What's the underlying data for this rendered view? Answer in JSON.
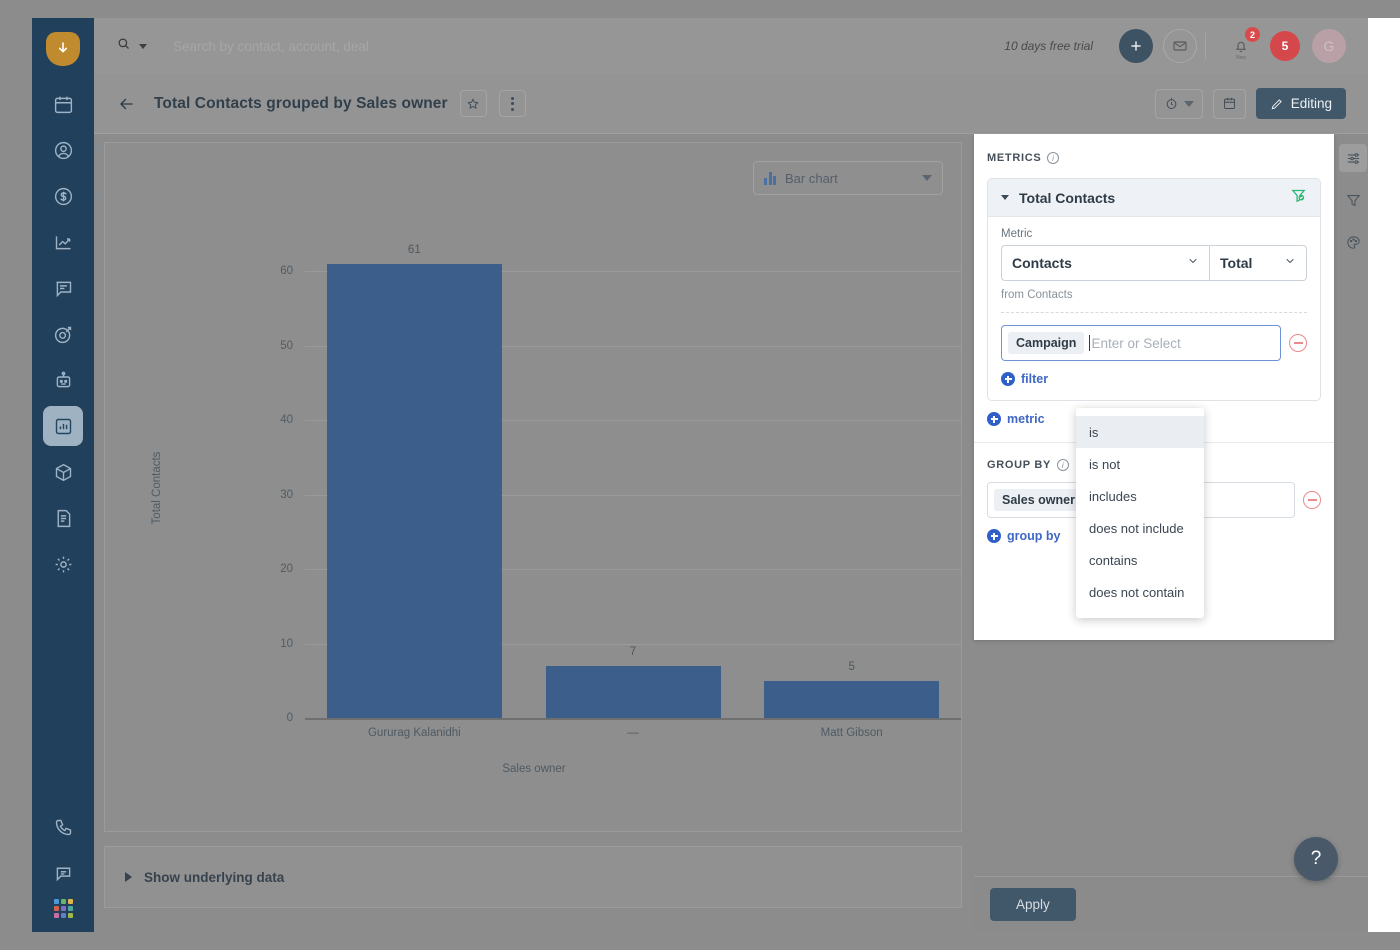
{
  "app": {
    "logo_icon": "shield-download-icon"
  },
  "sidebar": {
    "items": [
      {
        "name": "calendar",
        "icon": "calendar-icon",
        "active": false,
        "dots": false
      },
      {
        "name": "contacts",
        "icon": "person-icon",
        "active": false,
        "dots": true
      },
      {
        "name": "deals",
        "icon": "dollar-icon",
        "active": false,
        "dots": true
      },
      {
        "name": "analytics",
        "icon": "line-chart-icon",
        "active": false,
        "dots": false
      },
      {
        "name": "chat",
        "icon": "speech-icon",
        "active": false,
        "dots": true
      },
      {
        "name": "campaigns",
        "icon": "target-icon",
        "active": false,
        "dots": false
      },
      {
        "name": "bots",
        "icon": "bot-icon",
        "active": false,
        "dots": false
      },
      {
        "name": "reports",
        "icon": "bar-chart-icon",
        "active": true,
        "dots": false
      },
      {
        "name": "products",
        "icon": "cube-icon",
        "active": false,
        "dots": false
      },
      {
        "name": "documents",
        "icon": "document-icon",
        "active": false,
        "dots": false
      },
      {
        "name": "settings",
        "icon": "gear-icon",
        "active": false,
        "dots": false
      }
    ],
    "bottom_items": [
      {
        "name": "phone",
        "icon": "phone-icon"
      },
      {
        "name": "support",
        "icon": "chat-bubble-icon"
      },
      {
        "name": "apps",
        "icon": "app-grid-icon"
      }
    ],
    "grid_colors": [
      "#4a9ad4",
      "#69b36b",
      "#e0b44a",
      "#d4604f",
      "#7f6fc0",
      "#4fa8a0",
      "#c96fa8",
      "#5f7fc7",
      "#9fb84a"
    ]
  },
  "topbar": {
    "search": {
      "placeholder": "Search by contact, account, deal",
      "value": ""
    },
    "trial_text": "10 days free trial",
    "add_label": "+",
    "mail_icon": "envelope-icon",
    "notifications_badge": "2",
    "notifications_caption": "New",
    "tasks_count": "5",
    "avatar_initial": "G"
  },
  "page_header": {
    "back_icon": "arrow-left-icon",
    "title": "Total Contacts grouped by Sales owner",
    "favorite_icon": "star-icon",
    "more_icon": "kebab-menu-icon",
    "history_icon": "clock-icon",
    "schedule_icon": "calendar-icon",
    "edit_button": "Editing"
  },
  "chart_panel": {
    "chart_type": "Bar chart",
    "chart_type_icon": "bar-chart-icon",
    "underlying_data_label": "Show underlying data"
  },
  "chart_data": {
    "type": "bar",
    "title": "Total Contacts grouped by Sales owner",
    "categories": [
      "Gururag Kalanidhi",
      "—",
      "Matt Gibson"
    ],
    "values": [
      61,
      7,
      5
    ],
    "xlabel": "Sales owner",
    "ylabel": "Total Contacts",
    "ylim": [
      0,
      61
    ],
    "yticks": [
      0,
      10,
      20,
      30,
      40,
      50,
      60
    ],
    "bar_color": "#3b5f8a",
    "grid": true,
    "legend": "none",
    "data_labels": [
      "61",
      "7",
      "5"
    ]
  },
  "config_panel": {
    "metrics": {
      "section_label": "METRICS",
      "info_icon": "info-icon",
      "card_title": "Total Contacts",
      "collapse_icon": "chevron-down-icon",
      "filter_status_icon": "funnel-check-icon",
      "metric_field_label": "Metric",
      "metric_entity": "Contacts",
      "metric_aggregation": "Total",
      "from_text": "from Contacts",
      "filter": {
        "field_chip": "Campaign",
        "value_placeholder": "Enter or Select",
        "value": "",
        "remove_icon": "minus-circle-icon"
      },
      "add_filter_label": "filter",
      "add_metric_label": "metric"
    },
    "group_by": {
      "section_label": "GROUP BY",
      "info_icon": "info-icon",
      "field_chip": "Sales owner",
      "value": "",
      "remove_icon": "minus-circle-icon",
      "add_label": "group by"
    },
    "apply_label": "Apply"
  },
  "operator_dropdown": {
    "options": [
      {
        "label": "is",
        "selected": true
      },
      {
        "label": "is not",
        "selected": false
      },
      {
        "label": "includes",
        "selected": false
      },
      {
        "label": "does not include",
        "selected": false
      },
      {
        "label": "contains",
        "selected": false
      },
      {
        "label": "does not contain",
        "selected": false
      }
    ]
  },
  "right_rail": {
    "items": [
      {
        "name": "configure",
        "icon": "sliders-icon",
        "active": true
      },
      {
        "name": "filters",
        "icon": "funnel-icon",
        "active": false
      },
      {
        "name": "theme",
        "icon": "palette-icon",
        "active": false
      }
    ]
  },
  "help": {
    "label": "?"
  },
  "colors": {
    "sidebar_bg": "#20405c",
    "bar": "#3b5f8a",
    "accent_blue": "#2f60c9",
    "danger": "#d4474b",
    "dark_button": "#41576a",
    "green": "#2bb673"
  }
}
